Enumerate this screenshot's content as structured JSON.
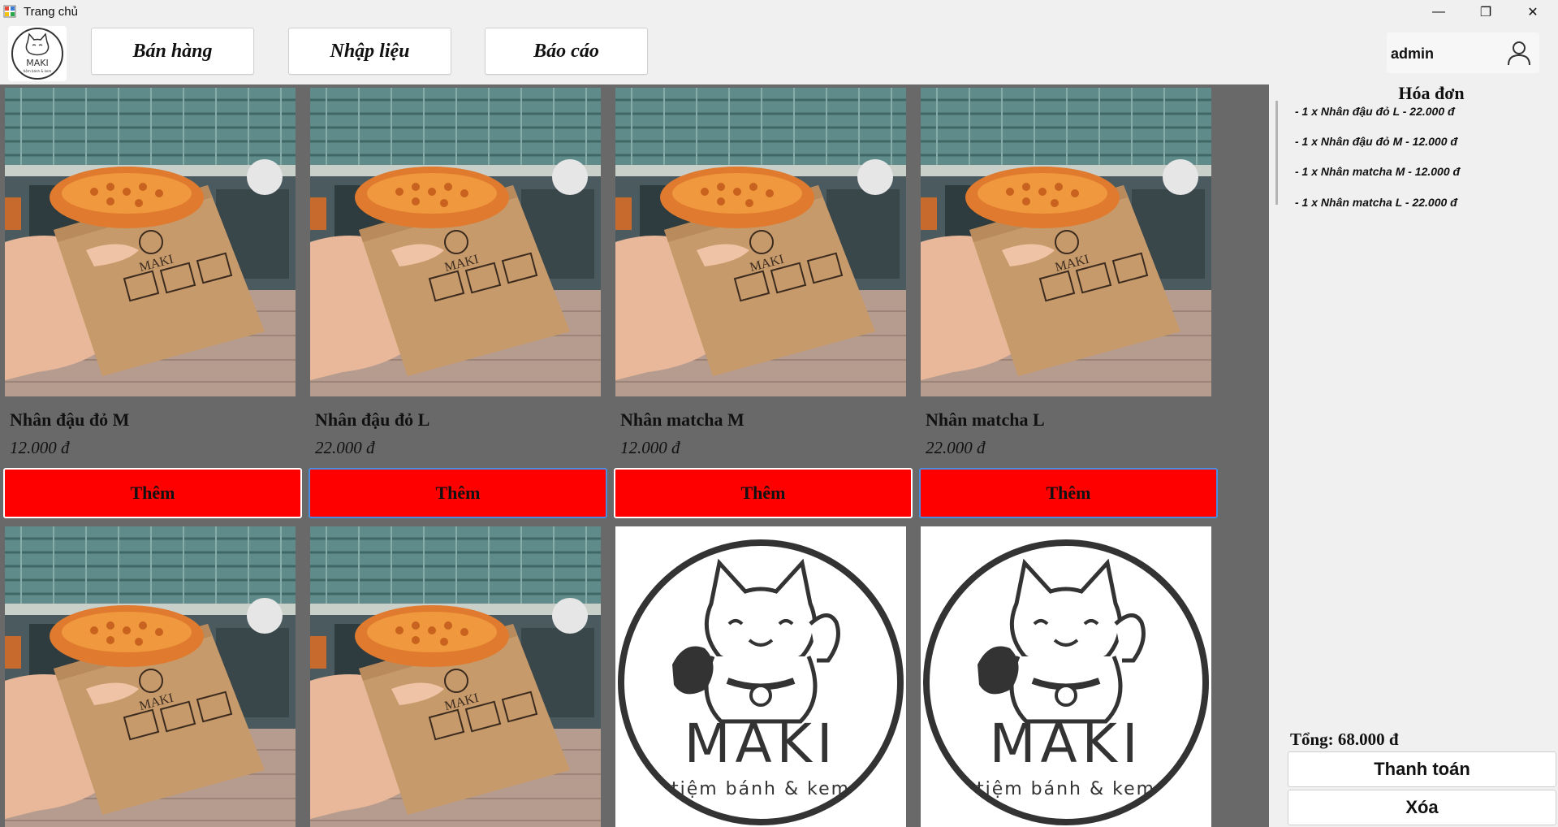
{
  "window": {
    "title": "Trang chủ",
    "minimize": "—",
    "restore": "❐",
    "close": "✕"
  },
  "nav": {
    "sell_label": "Bán hàng",
    "input_label": "Nhập liệu",
    "report_label": "Báo cáo"
  },
  "user": {
    "name": "admin"
  },
  "logo": {
    "brand": "MAKI",
    "tagline": "tiệm bánh & kem"
  },
  "products": [
    {
      "name": "Nhân đậu đỏ M",
      "price": "12.000 đ",
      "button": "Thêm",
      "image": "taiyaki-bag-photo"
    },
    {
      "name": "Nhân đậu đỏ L",
      "price": "22.000 đ",
      "button": "Thêm",
      "image": "taiyaki-bag-photo"
    },
    {
      "name": "Nhân matcha M",
      "price": "12.000 đ",
      "button": "Thêm",
      "image": "taiyaki-bag-photo"
    },
    {
      "name": "Nhân matcha L",
      "price": "22.000 đ",
      "button": "Thêm",
      "image": "taiyaki-bag-photo"
    },
    {
      "image": "taiyaki-bag-photo"
    },
    {
      "image": "taiyaki-bag-photo"
    },
    {
      "image": "maki-logo"
    },
    {
      "image": "maki-logo"
    }
  ],
  "invoice": {
    "title": "Hóa đơn",
    "items": [
      "- 1 x Nhân đậu đỏ L - 22.000 đ",
      "- 1 x Nhân đậu đỏ M - 12.000 đ",
      "- 1 x Nhân matcha M - 12.000 đ",
      "- 1 x Nhân matcha L - 22.000 đ"
    ],
    "total": "Tổng: 68.000 đ",
    "pay_label": "Thanh toán",
    "delete_label": "Xóa"
  },
  "colors": {
    "panel_bg": "#696969",
    "add_button": "#ff0000",
    "window_bg": "#f0f0f0"
  }
}
